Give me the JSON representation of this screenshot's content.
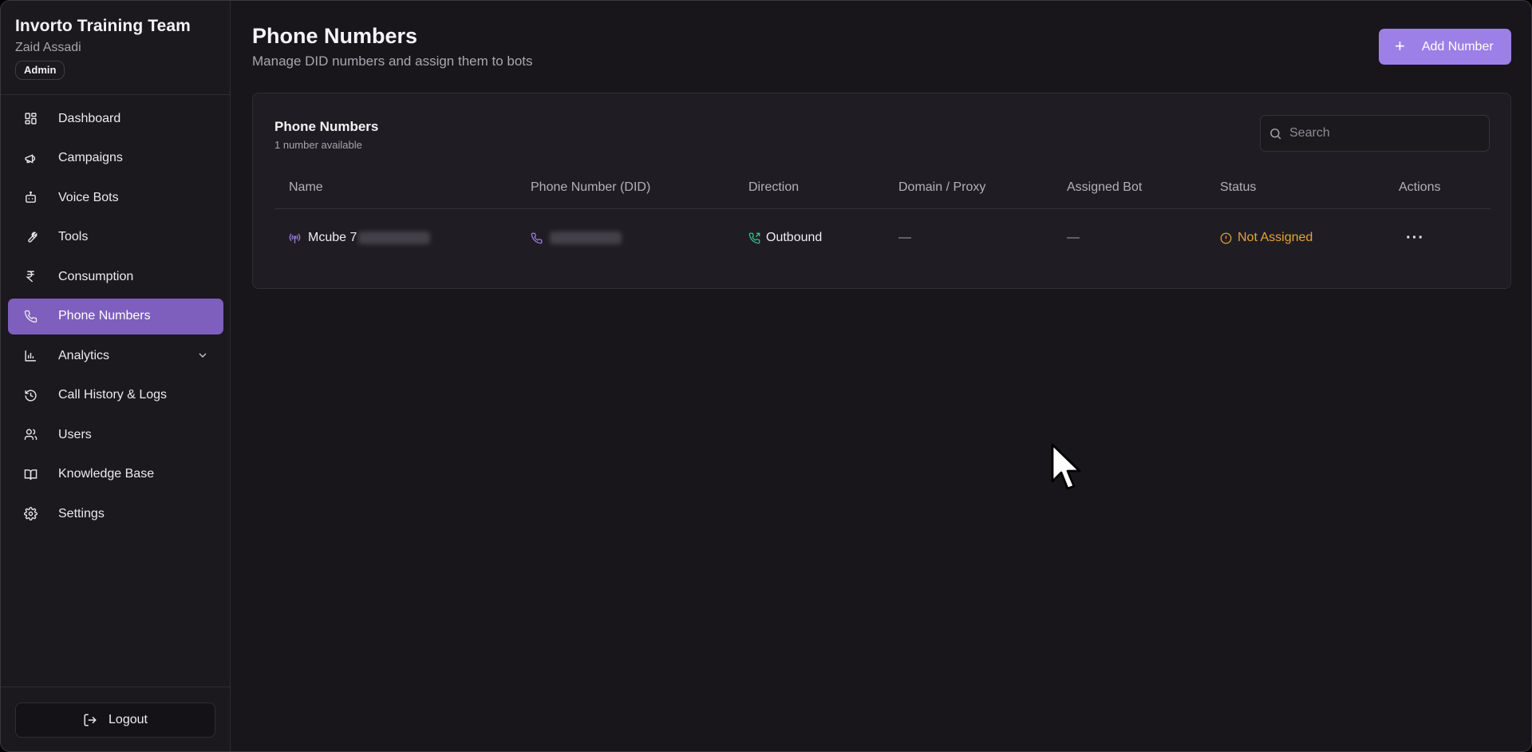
{
  "sidebar": {
    "team_name": "Invorto Training Team",
    "user_name": "Zaid Assadi",
    "role": "Admin",
    "items": [
      {
        "label": "Dashboard",
        "icon": "dashboard-icon"
      },
      {
        "label": "Campaigns",
        "icon": "megaphone-icon"
      },
      {
        "label": "Voice Bots",
        "icon": "bot-icon"
      },
      {
        "label": "Tools",
        "icon": "wrench-icon"
      },
      {
        "label": "Consumption",
        "icon": "rupee-icon"
      },
      {
        "label": "Phone Numbers",
        "icon": "phone-icon",
        "active": true
      },
      {
        "label": "Analytics",
        "icon": "bar-chart-icon",
        "expandable": true
      },
      {
        "label": "Call History & Logs",
        "icon": "history-icon"
      },
      {
        "label": "Users",
        "icon": "users-icon"
      },
      {
        "label": "Knowledge Base",
        "icon": "book-icon"
      },
      {
        "label": "Settings",
        "icon": "gear-icon"
      }
    ],
    "logout_label": "Logout"
  },
  "header": {
    "title": "Phone Numbers",
    "subtitle": "Manage DID numbers and assign them to bots",
    "add_button_label": "Add Number"
  },
  "card": {
    "title": "Phone Numbers",
    "subtitle": "1 number available",
    "search_placeholder": "Search",
    "columns": [
      "Name",
      "Phone Number (DID)",
      "Direction",
      "Domain / Proxy",
      "Assigned Bot",
      "Status",
      "Actions"
    ],
    "rows": [
      {
        "name": "Mcube 7",
        "phone_number": "",
        "direction": "Outbound",
        "domain_proxy": "—",
        "assigned_bot": "—",
        "status": "Not Assigned"
      }
    ]
  },
  "colors": {
    "accent": "#9d7fe8",
    "active_nav": "#7e5fbd",
    "status_warning": "#e8a13a",
    "outbound_icon": "#34c38f",
    "background": "#18161b"
  }
}
